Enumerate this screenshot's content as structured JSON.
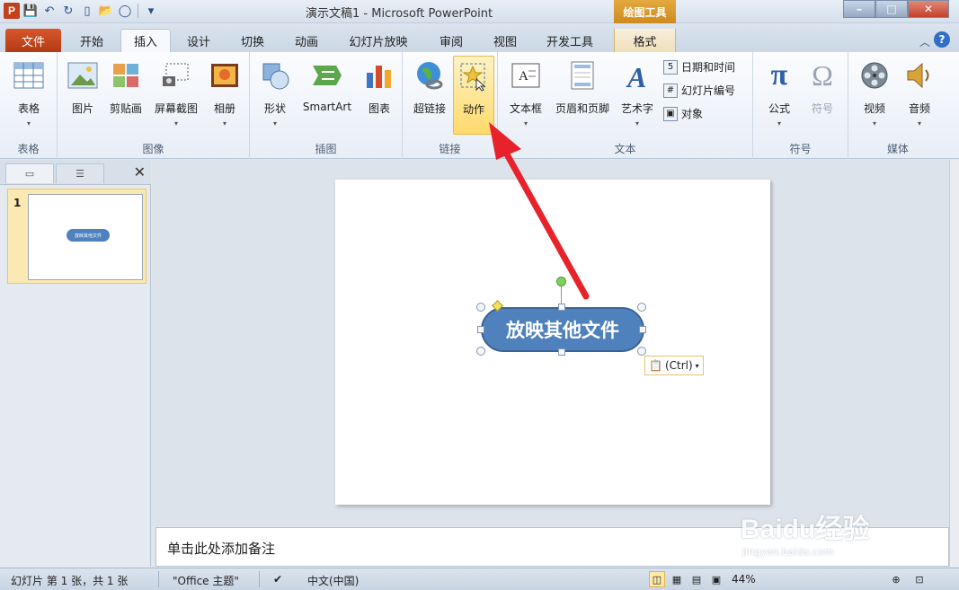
{
  "window": {
    "title": "演示文稿1 - Microsoft PowerPoint",
    "contextual_header": "绘图工具",
    "controls": {
      "minimize": "–",
      "maximize": "□",
      "close": "✕"
    }
  },
  "qat": {
    "app_letter": "P"
  },
  "tabs": [
    "文件",
    "开始",
    "插入",
    "设计",
    "切换",
    "动画",
    "幻灯片放映",
    "审阅",
    "视图",
    "开发工具",
    "格式"
  ],
  "active_tab": "插入",
  "ribbon": {
    "groups": {
      "tables": {
        "label": "表格",
        "table_btn": "表格"
      },
      "images": {
        "label": "图像",
        "picture": "图片",
        "clipart": "剪贴画",
        "screenshot": "屏幕截图",
        "album": "相册"
      },
      "illustrations": {
        "label": "插图",
        "shapes": "形状",
        "smartart": "SmartArt",
        "chart": "图表"
      },
      "links": {
        "label": "链接",
        "hyperlink": "超链接",
        "action": "动作"
      },
      "text": {
        "label": "文本",
        "textbox": "文本框",
        "header_footer": "页眉和页脚",
        "wordart": "艺术字",
        "datetime": "日期和时间",
        "slide_number": "幻灯片编号",
        "object": "对象"
      },
      "symbols": {
        "label": "符号",
        "equation": "公式",
        "symbol": "符号"
      },
      "media": {
        "label": "媒体",
        "video": "视频",
        "audio": "音频"
      }
    }
  },
  "slides_pane": {
    "slide_number": "1",
    "thumb_text": "放映其他文件"
  },
  "slide": {
    "shape_text": "放映其他文件",
    "paste_options": "(Ctrl)"
  },
  "notes": {
    "placeholder": "单击此处添加备注"
  },
  "status": {
    "slide_info": "幻灯片 第 1 张，共 1 张",
    "theme": "\"Office 主题\"",
    "language": "中文(中国)",
    "zoom": "44%"
  },
  "watermark": {
    "text": "Baidu经验",
    "sub": "jingyan.baidu.com"
  },
  "colors": {
    "accent": "#4f81bd",
    "file_tab": "#c4401b",
    "arrow": "#e8222a"
  }
}
